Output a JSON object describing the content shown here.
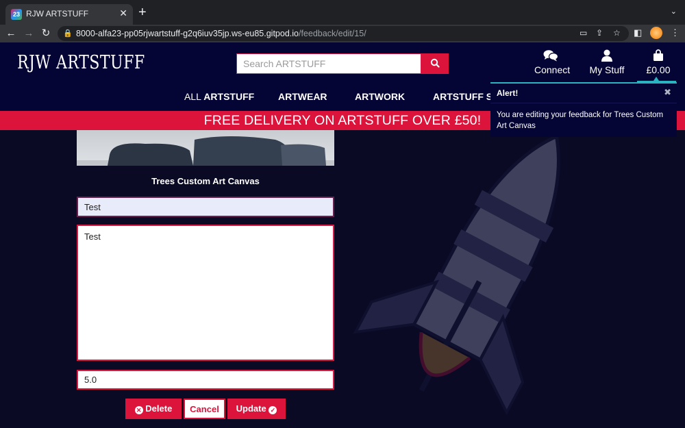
{
  "browser": {
    "tab_title": "RJW ARTSTUFF",
    "favicon_label": "23",
    "url_host": "8000-alfa23-pp05rjwartstuff-g2q6iuv35jp.ws-eu85.gitpod.io",
    "url_path": "/feedback/edit/15/"
  },
  "header": {
    "logo": "RJW ARTSTUFF",
    "search_placeholder": "Search ARTSTUFF",
    "links": [
      {
        "label": "Connect",
        "icon": "comments-icon"
      },
      {
        "label": "My Stuff",
        "icon": "user-icon"
      },
      {
        "label": "£0.00",
        "icon": "shopping-bag-icon"
      }
    ]
  },
  "main_nav": {
    "all_prefix": "ALL",
    "all_label": "ARTSTUFF",
    "artwear": "ARTWEAR",
    "artwork": "ARTWORK",
    "special": "ARTSTUFF SPI"
  },
  "banner": {
    "text": "FREE DELIVERY ON ARTSTUFF OVER £50!"
  },
  "form": {
    "product_name": "Trees Custom Art Canvas",
    "title_value": "Test",
    "body_value": "Test",
    "rating_value": "5.0",
    "delete_label": "Delete",
    "cancel_label": "Cancel",
    "update_label": "Update"
  },
  "toast": {
    "header": "Alert!",
    "message": "You are editing your feedback for Trees Custom Art Canvas"
  },
  "colors": {
    "accent": "#dc143c",
    "header_bg": "#050535",
    "toast_border": "#2ab3c0"
  }
}
